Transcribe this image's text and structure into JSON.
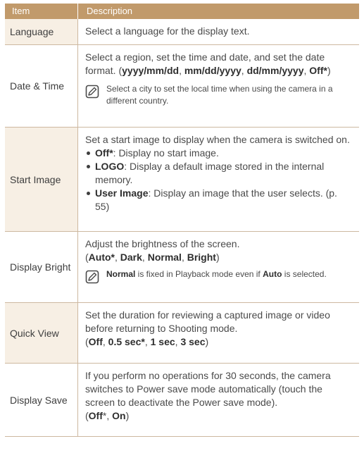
{
  "header": {
    "item": "Item",
    "description": "Description"
  },
  "rows": {
    "language": {
      "item": "Language",
      "desc": "Select a language for the display text."
    },
    "datetime": {
      "item": "Date & Time",
      "desc_a": "Select a region, set the time and date, and set the date format. (",
      "fmt1": "yyyy/mm/dd",
      "sep1": ", ",
      "fmt2": "mm/dd/yyyy",
      "sep2": ", ",
      "fmt3": "dd/mm/yyyy",
      "sep3": ", ",
      "fmt4": "Off*",
      "close": ")",
      "note": "Select a city to set the local time when using the camera in a different country."
    },
    "start": {
      "item": "Start Image",
      "intro": "Set a start image to display when the camera is switched on.",
      "b1_bold": "Off*",
      "b1_text": ": Display no start image.",
      "b2_bold": "LOGO",
      "b2_text": ": Display a default image stored in the internal memory.",
      "b3_bold": "User Image",
      "b3_text": ": Display an image that the user selects. (p. 55)"
    },
    "bright": {
      "item": "Display Bright",
      "desc": "Adjust the brightness of the screen.",
      "open": "(",
      "o1": "Auto*",
      "s1": ", ",
      "o2": "Dark",
      "s2": ", ",
      "o3": "Normal",
      "s3": ", ",
      "o4": "Bright",
      "close": ")",
      "note_b1": "Normal",
      "note_t1": " is fixed in Playback mode even if ",
      "note_b2": "Auto",
      "note_t2": " is selected."
    },
    "quick": {
      "item": "Quick View",
      "desc": "Set the duration for reviewing a captured image or video before returning to Shooting mode.",
      "open": "(",
      "o1": "Off",
      "s1": ", ",
      "o2": "0.5 sec*",
      "s2": ", ",
      "o3": "1 sec",
      "s3": ", ",
      "o4": "3 sec",
      "close": ")"
    },
    "save": {
      "item": "Display Save",
      "desc": "If you perform no operations for 30 seconds, the camera switches to Power save mode automatically (touch the screen to deactivate the Power save mode).",
      "open": "(",
      "o1": "Off",
      "star": "*",
      "s1": ", ",
      "o2": "On",
      "close": ")"
    }
  },
  "icons": {
    "note": "note-pencil-icon"
  },
  "colors": {
    "header_bg": "#c19a6b",
    "item_shade": "#f7efe4",
    "rule": "#cdb8a0"
  }
}
